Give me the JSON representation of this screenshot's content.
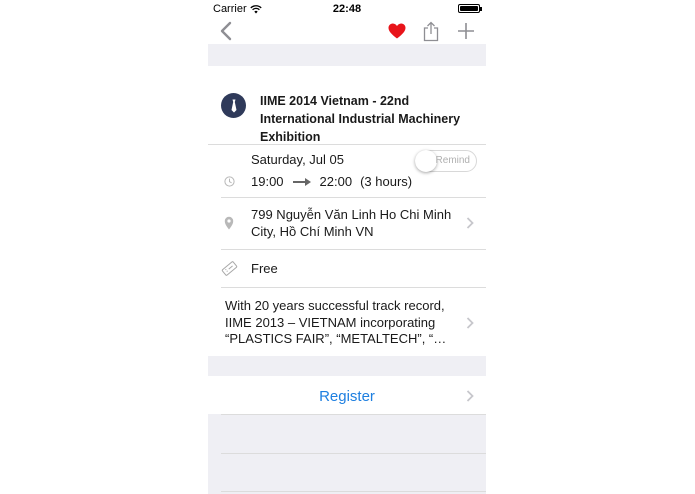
{
  "status_bar": {
    "carrier": "Carrier",
    "time": "22:48",
    "battery_level": 1.0
  },
  "nav": {
    "back_icon": "chevron-left-icon",
    "favorite_icon": "heart-icon",
    "favorite_color": "#e8141a",
    "share_icon": "share-icon",
    "add_icon": "plus-icon"
  },
  "event": {
    "title": "IIME 2014 Vietnam - 22nd International Industrial Machinery Exhibition",
    "category_icon": "tie-icon",
    "category_color": "#2f3a5a",
    "date": "Saturday, Jul 05",
    "time_start": "19:00",
    "time_end": "22:00",
    "duration": "(3 hours)",
    "remind_label": "Remind",
    "remind_on": false,
    "address_line1": "799 Nguyễn Văn Linh Ho Chi Minh",
    "address_line2": "City, Hồ Chí Minh VN",
    "price": "Free",
    "description_line1": "With 20 years successful track record,",
    "description_line2": "IIME 2013 – VIETNAM incorporating",
    "description_line3": "“PLASTICS FAIR”, “METALTECH”, “…"
  },
  "register": {
    "label": "Register",
    "color": "#1e7fe0"
  }
}
